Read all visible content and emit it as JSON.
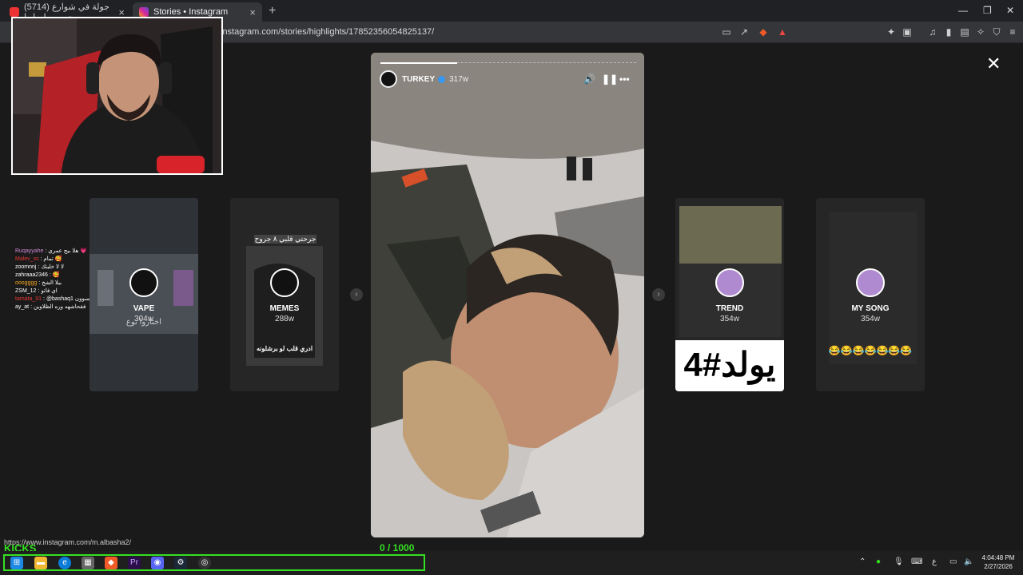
{
  "browser": {
    "tabs": [
      {
        "title": "(5714) جولة في شوارع وجي مسلسل ا..."
      },
      {
        "title": "Stories • Instagram"
      }
    ],
    "url": "instagram.com/stories/highlights/17852356054825137/",
    "status_url": "https://www.instagram.com/m.albasha2/"
  },
  "story": {
    "username": "TURKEY",
    "time": "317w",
    "progress_fraction": 0.3
  },
  "highlights": [
    {
      "title": "VAPE",
      "time": "304w",
      "caption": "اختاروا نوع"
    },
    {
      "title": "MEMES",
      "time": "288w",
      "header": "جرحتي قلبي ٨ جروح",
      "caption": "ادري قلب لو برشلونه"
    },
    {
      "title": "TREND",
      "time": "354w",
      "banner": "يولد#4"
    },
    {
      "title": "MY SONG",
      "time": "354w",
      "emojis": "😂😂😂😂😂😂😂"
    }
  ],
  "chat": [
    {
      "user": "Ruqayyahe",
      "text": "هلا بيج عمري 💗"
    },
    {
      "user": "Malev_ss",
      "text": "تمام 🥰"
    },
    {
      "user": "zoomnnj",
      "text": "لا لا خليتك"
    },
    {
      "user": "zahraaa2346",
      "text": "🥰"
    },
    {
      "user": "ooogggg",
      "text": "بيلا الشخ"
    },
    {
      "user": "ZSM_12",
      "text": "اي فاتو"
    },
    {
      "user": "tamata_91",
      "text": "@bashaq1 ركع التقليدين يسوون"
    },
    {
      "user": "ay_at",
      "text": "فقحاشهه وره الظلاوين"
    }
  ],
  "overlay": {
    "kicks_label": "KICKS",
    "counter": "0  / 1000"
  },
  "taskbar": {
    "time": "4:04:48 PM",
    "date": "2/27/2026",
    "lang": "ع"
  }
}
